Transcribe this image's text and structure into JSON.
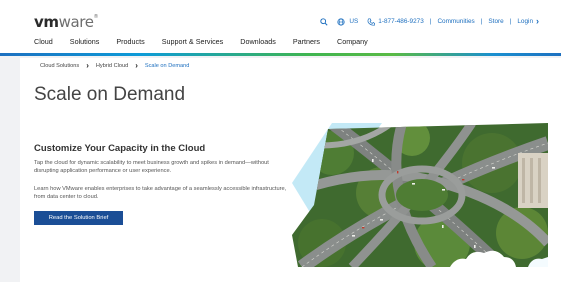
{
  "header": {
    "logo": {
      "bold": "vm",
      "rest": "ware",
      "mark": "®"
    },
    "utility": {
      "region": "US",
      "phone": "1-877-486-9273",
      "links": [
        "Communities",
        "Store",
        "Login"
      ],
      "login_chevron": "›"
    },
    "nav": [
      "Cloud",
      "Solutions",
      "Products",
      "Support & Services",
      "Downloads",
      "Partners",
      "Company"
    ]
  },
  "breadcrumb": {
    "items": [
      "Cloud Solutions",
      "Hybrid Cloud",
      "Scale on Demand"
    ],
    "separator": "›"
  },
  "page": {
    "title": "Scale on Demand",
    "subtitle": "Customize Your Capacity in the Cloud",
    "paragraph1": "Tap the cloud for dynamic scalability to meet business growth and spikes in demand—without disrupting application performance or user experience.",
    "paragraph2": "Learn how VMware enables enterprises to take advantage of a seamlessly accessible infrastructure, from data center to cloud.",
    "cta_label": "Read the Solution Brief"
  },
  "icons": {
    "search": "search-icon",
    "globe": "globe-icon",
    "phone": "phone-icon",
    "chevron": "chevron-right-icon"
  },
  "colors": {
    "link_blue": "#1d6fbf",
    "button_blue": "#1b4e96",
    "accent_cyan": "#6ec7e8"
  }
}
